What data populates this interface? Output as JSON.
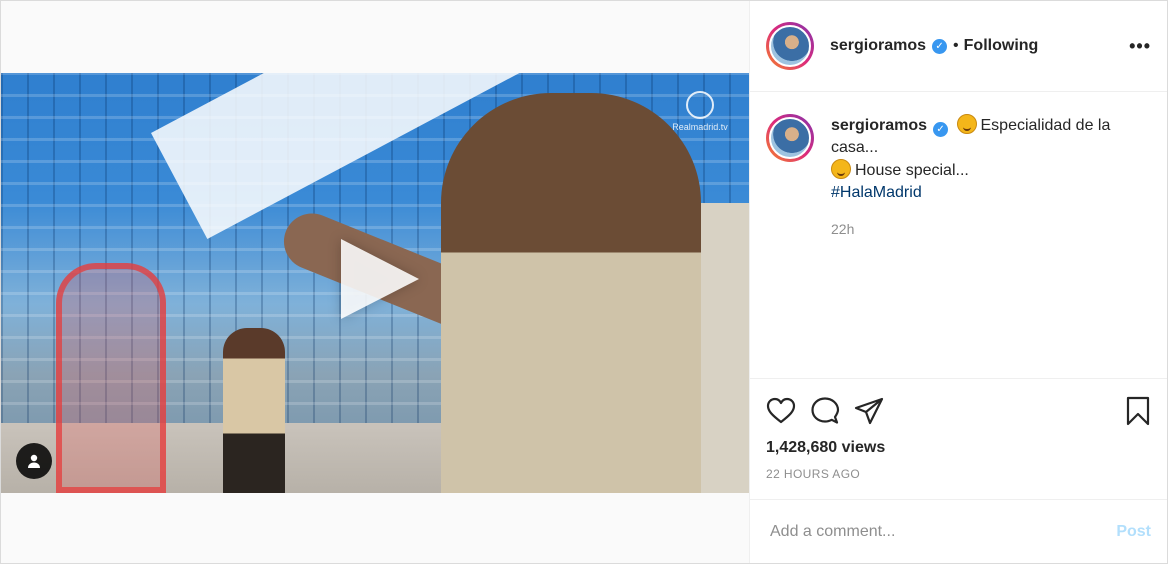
{
  "header": {
    "username": "sergioramos",
    "dot": "•",
    "follow_status": "Following",
    "more": "•••"
  },
  "video": {
    "watermark": "Realmadrid.tv"
  },
  "caption": {
    "username": "sergioramos",
    "line1": "Especialidad de la casa...",
    "line2": "House special...",
    "hashtag": "#HalaMadrid",
    "time": "22h"
  },
  "stats": {
    "views": "1,428,680 views",
    "posted": "22 HOURS AGO"
  },
  "comment": {
    "placeholder": "Add a comment...",
    "post_label": "Post"
  },
  "colors": {
    "verified": "#3897f0",
    "hashtag": "#00376b",
    "post_disabled": "#b2dffc"
  }
}
